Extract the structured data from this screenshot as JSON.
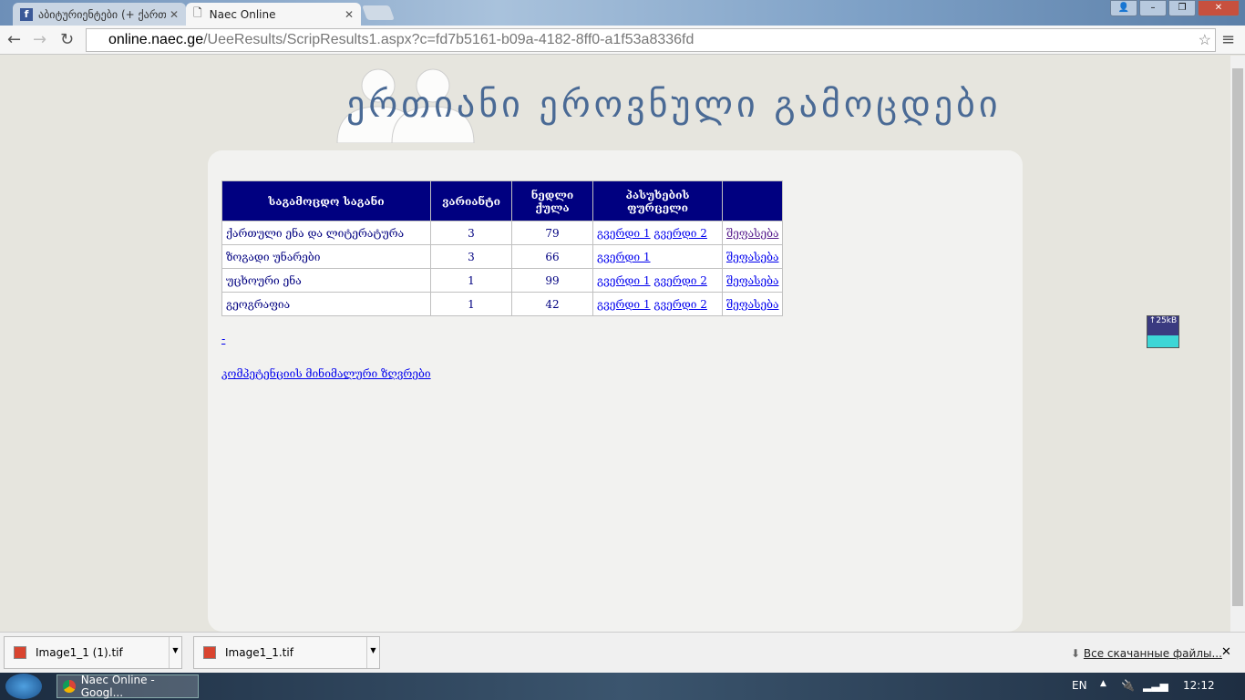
{
  "browser": {
    "tabs": [
      {
        "label": "აბიტურიენტები (+ ქართ",
        "icon": "facebook-icon"
      },
      {
        "label": "Naec Online",
        "icon": "page-icon"
      }
    ],
    "url_host": "online.naec.ge",
    "url_path": "/UeeResults/ScripResults1.aspx?c=fd7b5161-b09a-4182-8ff0-a1f53a8336fd"
  },
  "page": {
    "title": "ერთიანი ეროვნული გამოცდები",
    "table": {
      "headers": [
        "საგამოცდო საგანი",
        "ვარიანტი",
        "ნედლი ქულა",
        "პასუხების ფურცელი",
        ""
      ],
      "rows": [
        {
          "subject": "ქართული ენა და ლიტერატურა",
          "variant": "3",
          "score": "79",
          "page1": "გვერდი 1",
          "page2": "გვერდი 2",
          "eval": "შეფასება"
        },
        {
          "subject": "ზოგადი უნარები",
          "variant": "3",
          "score": "66",
          "page1": "გვერდი 1",
          "page2": "",
          "eval": "შეფასება"
        },
        {
          "subject": "უცხოური ენა",
          "variant": "1",
          "score": "99",
          "page1": "გვერდი 1",
          "page2": "გვერდი 2",
          "eval": "შეფასება"
        },
        {
          "subject": "გეოგრაფია",
          "variant": "1",
          "score": "42",
          "page1": "გვერდი 1",
          "page2": "გვერდი 2",
          "eval": "შეფასება"
        }
      ]
    },
    "dash_link": "-",
    "min_link": "კომპეტენციის მინიმალური ზღვრები",
    "widget": "↑25kB"
  },
  "downloads": {
    "items": [
      "Image1_1 (1).tif",
      "Image1_1.tif"
    ],
    "all_files": "Все скачанные файлы..."
  },
  "taskbar": {
    "task": "Naec Online - Googl...",
    "lang": "EN",
    "time": "12:12"
  }
}
